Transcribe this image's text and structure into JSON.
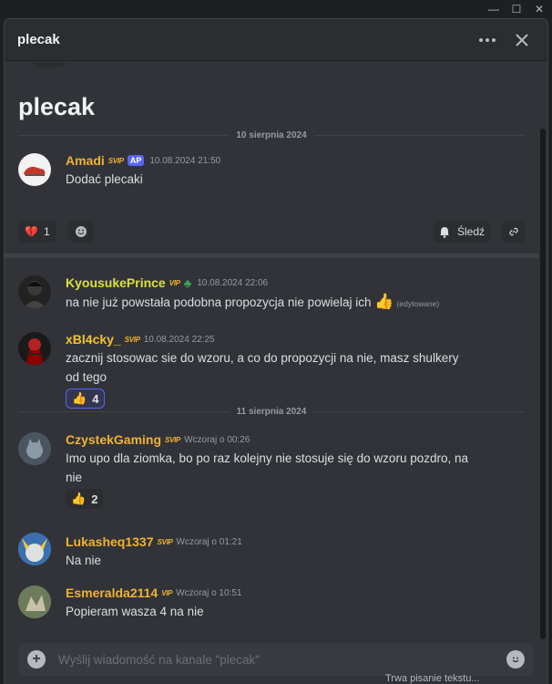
{
  "window": {
    "minimize": "—",
    "maximize": "☐",
    "close": "✕"
  },
  "header": {
    "title": "plecak",
    "more_icon": "more-icon",
    "close_icon": "close-icon"
  },
  "thread": {
    "title": "plecak"
  },
  "dividers": [
    "10 sierpnia 2024",
    "11 sierpnia 2024"
  ],
  "starter": {
    "author": "Amadi",
    "vip": "SVIP",
    "badge": "AP",
    "timestamp": "10.08.2024 21:50",
    "text": "Dodać plecaki",
    "reaction_emoji": "💔",
    "reaction_count": "1",
    "follow_label": "Śledź"
  },
  "messages": [
    {
      "author": "KyousukePrince",
      "vip": "VIP",
      "timestamp": "10.08.2024 22:06",
      "text": "na nie już powstała podobna propozycja nie powielaj ich",
      "emoji": "👍",
      "edited": "(edytowane)"
    },
    {
      "author": "xBl4cky_",
      "vip": "SVIP",
      "timestamp": "10.08.2024 22:25",
      "text": "zacznij stosowac sie do wzoru, a co do propozycji na nie, masz shulkery od tego",
      "reaction_emoji": "👍",
      "reaction_count": "4"
    },
    {
      "author": "CzystekGaming",
      "vip": "SVIP",
      "timestamp": "Wczoraj o 00:26",
      "text": "Imo upo dla ziomka, bo po raz kolejny nie stosuje się do wzoru pozdro, na nie",
      "reaction_emoji": "👍",
      "reaction_count": "2"
    },
    {
      "author": "Lukasheq1337",
      "vip": "SVIP",
      "timestamp": "Wczoraj o 01:21",
      "text": "Na nie"
    },
    {
      "author": "Esmeralda2114",
      "vip": "VIP",
      "timestamp": "Wczoraj o 10:51",
      "text": "Popieram wasza 4 na nie"
    }
  ],
  "composer": {
    "placeholder": "Wyślij wiadomość na kanale \"plecak\""
  },
  "typing": "Trwa pisanie tekstu..."
}
